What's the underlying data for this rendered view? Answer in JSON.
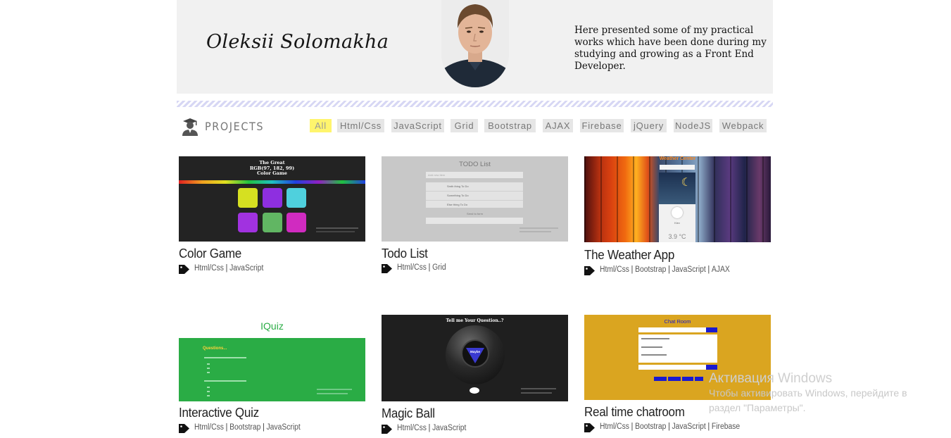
{
  "header": {
    "name": "Oleksii Solomakha",
    "intro": "Here presented some of my practical works which have been done during my studying and growing as a Front End Developer."
  },
  "projects": {
    "title": "PROJECTS",
    "icon": "graduate-icon",
    "filters": [
      "All",
      "Html/Css",
      "JavaScript",
      "Grid",
      "Bootstrap",
      "AJAX",
      "Firebase",
      "jQuery",
      "NodeJS",
      "Webpack"
    ],
    "active_filter": "All"
  },
  "cards": [
    {
      "title": "Color Game",
      "tags": [
        "Html/Css",
        "JavaScript"
      ],
      "thumb": {
        "heading1": "The Great",
        "heading2": "RGB(97, 182, 99)",
        "heading3": "Color Game"
      }
    },
    {
      "title": "Todo List",
      "tags": [
        "Html/Css",
        "Grid"
      ],
      "thumb": {
        "heading": "TODO List",
        "placeholder": "Add new item",
        "items": [
          "Smth thing To Do",
          "Something To Do",
          "Else thing To Do"
        ],
        "footer": "Send to form"
      }
    },
    {
      "title": "The Weather App",
      "tags": [
        "Html/Css",
        "Bootstrap",
        "JavaScript",
        "AJAX"
      ],
      "thumb": {
        "heading": "Weather Center",
        "temp": "3.9 °C",
        "city": "Kiev"
      }
    },
    {
      "title": "Interactive Quiz",
      "tags": [
        "Html/Css",
        "Bootstrap",
        "JavaScript"
      ],
      "thumb": {
        "heading": "IQuiz",
        "subheading": "Questions..."
      }
    },
    {
      "title": "Magic Ball",
      "tags": [
        "Html/Css",
        "JavaScript"
      ],
      "thumb": {
        "heading": "Tell me Your Question..?",
        "answer": "Maybe"
      }
    },
    {
      "title": "Real time chatroom",
      "tags": [
        "Html/Css",
        "Bootstrap",
        "JavaScript",
        "Firebase"
      ],
      "thumb": {
        "heading": "Chat Room"
      }
    }
  ],
  "watermark": {
    "line1": "Активация Windows",
    "line2": "Чтобы активировать Windows, перейдите в",
    "line3": "раздел \"Параметры\"."
  },
  "colors": {
    "header_bg": "#f1f1f1",
    "active_filter_bg": "#fff56d",
    "filter_bg": "#e6e6e6",
    "quiz_green": "#2aac45",
    "chat_gold": "#daa520"
  }
}
